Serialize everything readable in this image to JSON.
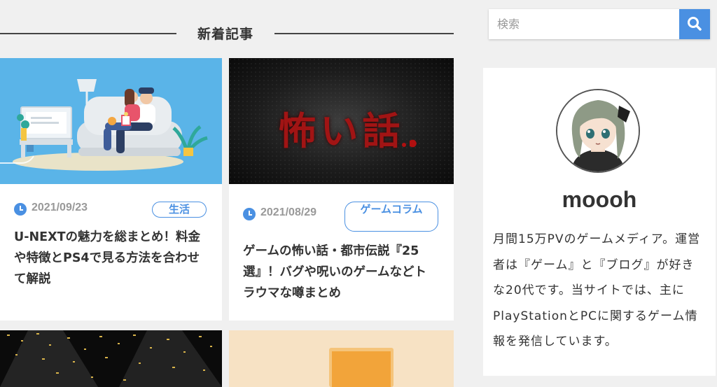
{
  "section": {
    "title": "新着記事"
  },
  "posts": [
    {
      "date": "2021/09/23",
      "tag": "生活",
      "title": "U-NEXTの魅力を総まとめ！料金や特徴とPS4で見る方法を合わせて解説"
    },
    {
      "date": "2021/08/29",
      "tag": "ゲームコラム",
      "title": "ゲームの怖い話・都市伝説『25選』！バグや呪いのゲームなどトラウマな噂まとめ",
      "thumb_text": "怖い話"
    }
  ],
  "search": {
    "placeholder": "検索"
  },
  "profile": {
    "name": "moooh",
    "description": "月間15万PVのゲームメディア。運営者は『ゲーム』と『ブログ』が好きな20代です。当サイトでは、主にPlayStationとPCに関するゲーム情報を発信しています。"
  },
  "colors": {
    "accent": "#4a90e2",
    "background": "#f0f0f0"
  },
  "icons": {
    "search": "search-icon",
    "date": "clock-icon"
  }
}
